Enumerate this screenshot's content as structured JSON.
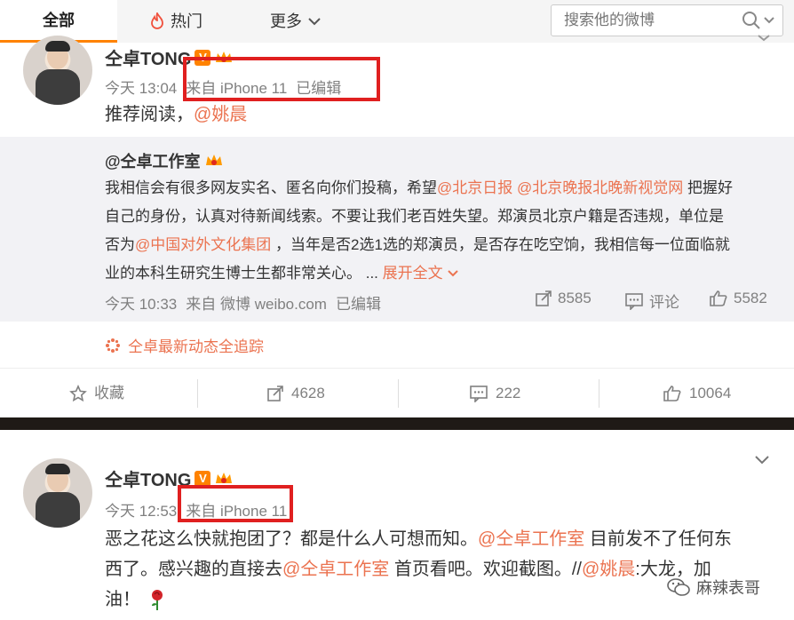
{
  "tabs": {
    "all": "全部",
    "hot": "热门",
    "more": "更多"
  },
  "search": {
    "placeholder": "搜索他的微博"
  },
  "post1": {
    "author": "仝卓TONG",
    "time": "今天 13:04",
    "source": "来自 iPhone 11",
    "edited": "已编辑",
    "text_prefix": "推荐阅读，",
    "mention": "@姚晨",
    "repost": {
      "author": "@仝卓工作室",
      "line1_a": "我相信会有很多网友实名、匿名向你们投稿，希望",
      "line1_m1": "@北京日报",
      "line1_m2": "@北京晚报北晚新视觉网",
      "line1_b": " 把握好",
      "line2": "自己的身份，认真对待新闻线索。不要让我们老百姓失望。郑演员北京户籍是否违规，单位是",
      "line3_a": "否为",
      "line3_m": "@中国对外文化集团",
      "line3_b": " ，当年是否2选1选的郑演员，是否存在吃空饷，我相信每一位面临就",
      "line4": "业的本科生研究生博士生都非常关心。 ...",
      "expand": "展开全文",
      "time": "今天 10:33",
      "source": "来自 微博 weibo.com",
      "edited": "已编辑",
      "reposts": "8585",
      "comment_label": "评论",
      "likes": "5582"
    },
    "track": "仝卓最新动态全追踪",
    "actions": {
      "favorite": "收藏",
      "reposts": "4628",
      "comments": "222",
      "likes": "10064"
    }
  },
  "post2": {
    "author": "仝卓TONG",
    "time": "今天 12:53",
    "source": "来自 iPhone 11",
    "line1_a": "恶之花这么快就抱团了？都是什么人可想而知。",
    "line1_m": "@仝卓工作室",
    "line1_b": " 目前发不了任何东",
    "line2_a": "西了。感兴趣的直接去",
    "line2_m": "@仝卓工作室",
    "line2_b": " 首页看吧。欢迎截图。//",
    "line2_m2": "@姚晨",
    "line2_c": ":大龙，加",
    "line3": "油！"
  },
  "watermark": "麻辣表哥",
  "colors": {
    "accent": "#ff8200",
    "link": "#eb7350",
    "highlight_box": "#e02020"
  }
}
